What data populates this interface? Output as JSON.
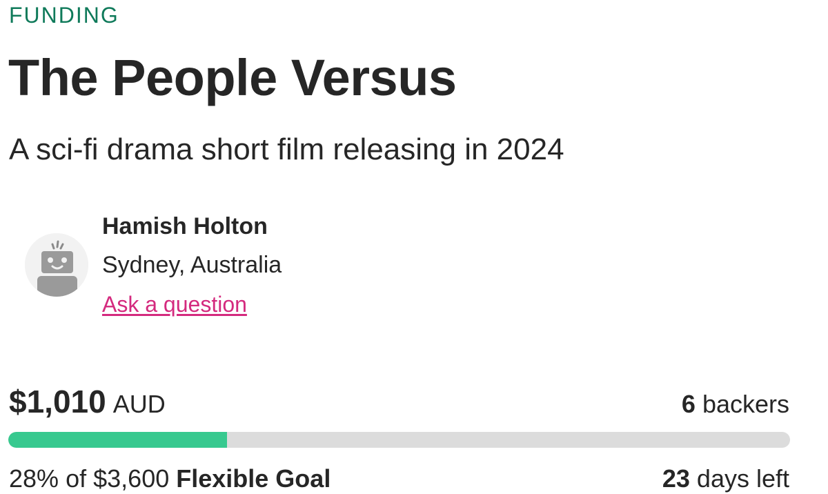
{
  "campaign": {
    "status": "FUNDING",
    "title": "The People Versus",
    "subtitle": "A sci-fi drama short film releasing in 2024"
  },
  "creator": {
    "name": "Hamish Holton",
    "location": "Sydney, Australia",
    "ask_link": "Ask a question",
    "avatar_icon": "robot-avatar-icon"
  },
  "funding": {
    "raised_amount": "$1,010",
    "currency": "AUD",
    "backers_count": "6",
    "backers_label": "backers",
    "progress_fraction": 0.28,
    "percent_text": "28%",
    "of_text": "of",
    "goal_amount": "$3,600",
    "goal_type": "Flexible Goal",
    "days_count": "23",
    "days_label": "days left"
  },
  "colors": {
    "status_label": "#0f7a5a",
    "link": "#d42a7e",
    "progress_fill": "#37c98f",
    "progress_track": "#dcdcdc",
    "text": "#262626"
  }
}
